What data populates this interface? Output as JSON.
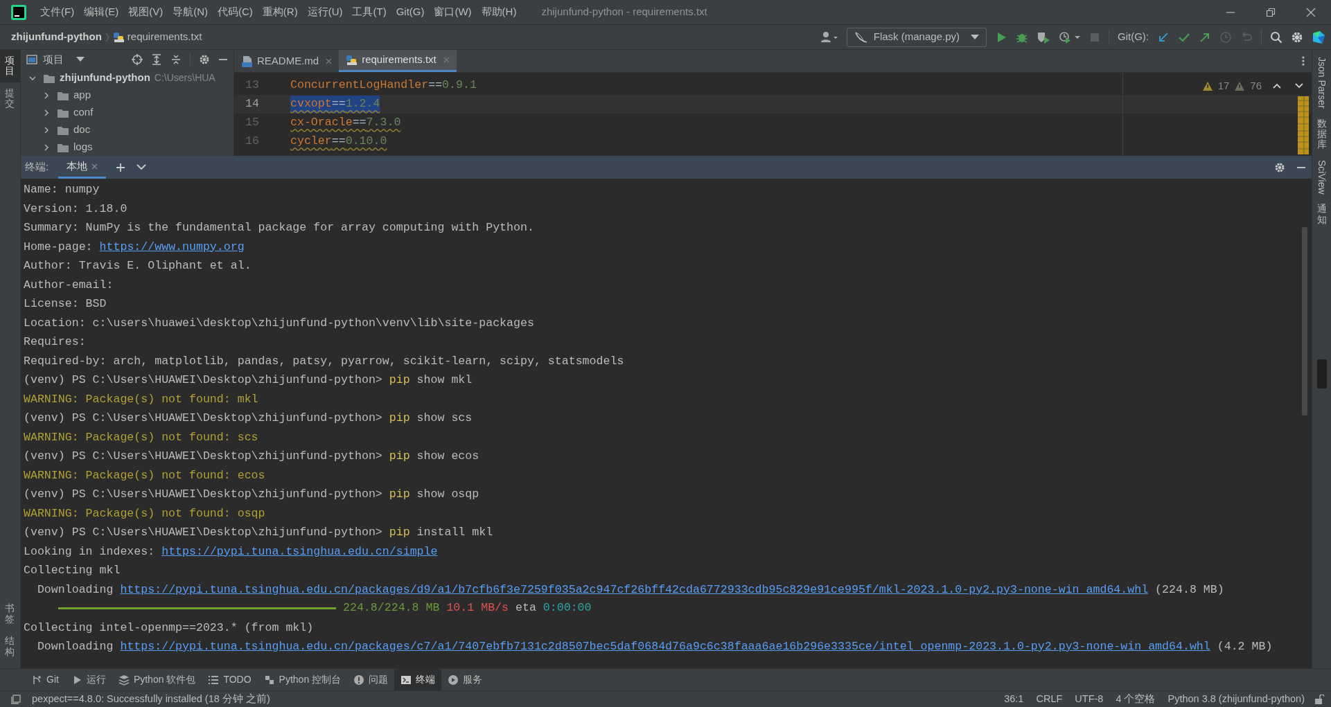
{
  "title_bar": {
    "menus": [
      "文件(F)",
      "编辑(E)",
      "视图(V)",
      "导航(N)",
      "代码(C)",
      "重构(R)",
      "运行(U)",
      "工具(T)",
      "Git(G)",
      "窗口(W)",
      "帮助(H)"
    ],
    "title": "zhijunfund-python - requirements.txt"
  },
  "nav_bar": {
    "breadcrumbs": [
      {
        "text": "zhijunfund-python",
        "kind": "project"
      },
      {
        "text": "requirements.txt",
        "kind": "file"
      }
    ],
    "run_config": "Flask (manage.py)",
    "git_label": "Git(G):"
  },
  "left_stripe": {
    "top": [
      {
        "label": "项目",
        "selected": true
      },
      {
        "label": "提交",
        "selected": false
      }
    ],
    "bottom": [
      {
        "label": "书签",
        "selected": false
      },
      {
        "label": "结构",
        "selected": false
      }
    ]
  },
  "project_panel": {
    "title": "项目",
    "tree": [
      {
        "name": "zhijunfund-python",
        "path": "C:\\Users\\HUA",
        "expanded": true,
        "children": [
          {
            "name": "app",
            "expanded": false
          },
          {
            "name": "conf",
            "expanded": false
          },
          {
            "name": "doc",
            "expanded": false
          },
          {
            "name": "logs",
            "expanded": false
          }
        ]
      }
    ]
  },
  "editor": {
    "tabs": [
      {
        "label": "README.md",
        "kind": "markdown",
        "selected": false
      },
      {
        "label": "requirements.txt",
        "kind": "text",
        "selected": true
      }
    ],
    "warnings": "17",
    "weak_warnings": "76",
    "lines": [
      {
        "number": "13",
        "package": "ConcurrentLogHandler",
        "operator": "==",
        "version": "0.9.1",
        "selected": false,
        "warning": false
      },
      {
        "number": "14",
        "package": "cvxopt",
        "operator": "==",
        "version": "1.2.4",
        "selected": true,
        "warning": true
      },
      {
        "number": "15",
        "package": "cx-Oracle",
        "operator": "==",
        "version": "7.3.0",
        "selected": false,
        "warning": true
      },
      {
        "number": "16",
        "package": "cycler",
        "operator": "==",
        "version": "0.10.0",
        "selected": false,
        "warning": true
      }
    ]
  },
  "terminal": {
    "label": "终端:",
    "tabs": [
      {
        "label": "本地",
        "selected": true
      }
    ],
    "lines": [
      {
        "segments": [
          {
            "kind": "text",
            "text": "Name: numpy"
          }
        ]
      },
      {
        "segments": [
          {
            "kind": "text",
            "text": "Version: 1.18.0"
          }
        ]
      },
      {
        "segments": [
          {
            "kind": "text",
            "text": "Summary: NumPy is the fundamental package for array computing with Python."
          }
        ]
      },
      {
        "segments": [
          {
            "kind": "text",
            "text": "Home-page: "
          },
          {
            "kind": "link",
            "text": "https://www.numpy.org"
          }
        ]
      },
      {
        "segments": [
          {
            "kind": "text",
            "text": "Author: Travis E. Oliphant et al."
          }
        ]
      },
      {
        "segments": [
          {
            "kind": "text",
            "text": "Author-email:"
          }
        ]
      },
      {
        "segments": [
          {
            "kind": "text",
            "text": "License: BSD"
          }
        ]
      },
      {
        "segments": [
          {
            "kind": "text",
            "text": "Location: c:\\users\\huawei\\desktop\\zhijunfund-python\\venv\\lib\\site-packages"
          }
        ]
      },
      {
        "segments": [
          {
            "kind": "text",
            "text": "Requires:"
          }
        ]
      },
      {
        "segments": [
          {
            "kind": "text",
            "text": "Required-by: arch, matplotlib, pandas, patsy, pyarrow, scikit-learn, scipy, statsmodels"
          }
        ]
      },
      {
        "segments": [
          {
            "kind": "text",
            "text": "(venv) PS C:\\Users\\HUAWEI\\Desktop\\zhijunfund-python> "
          },
          {
            "kind": "command",
            "text": "pip"
          },
          {
            "kind": "text",
            "text": " show mkl"
          }
        ]
      },
      {
        "segments": [
          {
            "kind": "warning",
            "text": "WARNING: Package(s) not found: mkl"
          }
        ]
      },
      {
        "segments": [
          {
            "kind": "text",
            "text": "(venv) PS C:\\Users\\HUAWEI\\Desktop\\zhijunfund-python> "
          },
          {
            "kind": "command",
            "text": "pip"
          },
          {
            "kind": "text",
            "text": " show scs"
          }
        ]
      },
      {
        "segments": [
          {
            "kind": "warning",
            "text": "WARNING: Package(s) not found: scs"
          }
        ]
      },
      {
        "segments": [
          {
            "kind": "text",
            "text": "(venv) PS C:\\Users\\HUAWEI\\Desktop\\zhijunfund-python> "
          },
          {
            "kind": "command",
            "text": "pip"
          },
          {
            "kind": "text",
            "text": " show ecos"
          }
        ]
      },
      {
        "segments": [
          {
            "kind": "warning",
            "text": "WARNING: Package(s) not found: ecos"
          }
        ]
      },
      {
        "segments": [
          {
            "kind": "text",
            "text": "(venv) PS C:\\Users\\HUAWEI\\Desktop\\zhijunfund-python> "
          },
          {
            "kind": "command",
            "text": "pip"
          },
          {
            "kind": "text",
            "text": " show osqp"
          }
        ]
      },
      {
        "segments": [
          {
            "kind": "warning",
            "text": "WARNING: Package(s) not found: osqp"
          }
        ]
      },
      {
        "segments": [
          {
            "kind": "text",
            "text": "(venv) PS C:\\Users\\HUAWEI\\Desktop\\zhijunfund-python> "
          },
          {
            "kind": "command",
            "text": "pip"
          },
          {
            "kind": "text",
            "text": " install mkl"
          }
        ]
      },
      {
        "segments": [
          {
            "kind": "text",
            "text": "Looking in indexes: "
          },
          {
            "kind": "link",
            "text": "https://pypi.tuna.tsinghua.edu.cn/simple"
          }
        ]
      },
      {
        "segments": [
          {
            "kind": "text",
            "text": "Collecting mkl"
          }
        ]
      },
      {
        "segments": [
          {
            "kind": "text",
            "text": "  Downloading "
          },
          {
            "kind": "link",
            "text": "https://pypi.tuna.tsinghua.edu.cn/packages/d9/a1/b7cfb6f3e7259f035a2c947cf26bff42cda6772933cdb95c829e91ce995f/mkl-2023.1.0-py2.py3-none-win_amd64.whl"
          },
          {
            "kind": "text",
            "text": " (224.8 MB)"
          }
        ]
      },
      {
        "kind": "progress",
        "level": 1,
        "segments": [
          {
            "kind": "size",
            "text": "224.8/224.8 MB"
          },
          {
            "kind": "speed",
            "text": "10.1 MB/s"
          },
          {
            "kind": "text",
            "text": "eta"
          },
          {
            "kind": "eta",
            "text": "0:00:00"
          }
        ]
      },
      {
        "segments": [
          {
            "kind": "text",
            "text": "Collecting intel-openmp==2023.* (from mkl)"
          }
        ]
      },
      {
        "segments": [
          {
            "kind": "text",
            "text": "  Downloading "
          },
          {
            "kind": "link",
            "text": "https://pypi.tuna.tsinghua.edu.cn/packages/c7/a1/7407ebfb7131c2d8507bec5daf0684d76a9c6c38faaa6ae16b296e3335ce/intel_openmp-2023.1.0-py2.py3-none-win_amd64.whl"
          },
          {
            "kind": "text",
            "text": " (4.2 MB)"
          }
        ]
      }
    ]
  },
  "right_stripe": [
    {
      "label": "Json Parser",
      "kind": "latin"
    },
    {
      "label": "数据库",
      "kind": "cjk"
    },
    {
      "label": "SciView",
      "kind": "latin"
    },
    {
      "label": "通知",
      "kind": "cjk"
    }
  ],
  "tool_tabs": [
    {
      "label": "Git",
      "kind": "git",
      "selected": false
    },
    {
      "label": "运行",
      "kind": "run",
      "selected": false
    },
    {
      "label": "Python 软件包",
      "kind": "packages",
      "selected": false
    },
    {
      "label": "TODO",
      "kind": "todo",
      "selected": false
    },
    {
      "label": "Python 控制台",
      "kind": "console",
      "selected": false
    },
    {
      "label": "问题",
      "kind": "problems",
      "selected": false
    },
    {
      "label": "终端",
      "kind": "terminal",
      "selected": true
    },
    {
      "label": "服务",
      "kind": "services",
      "selected": false
    }
  ],
  "status_bar": {
    "message": "pexpect==4.8.0: Successfully installed (18 分钟 之前)",
    "items": [
      "36:1",
      "CRLF",
      "UTF-8",
      "4 个空格",
      "Python 3.8 (zhijunfund-python)"
    ]
  }
}
